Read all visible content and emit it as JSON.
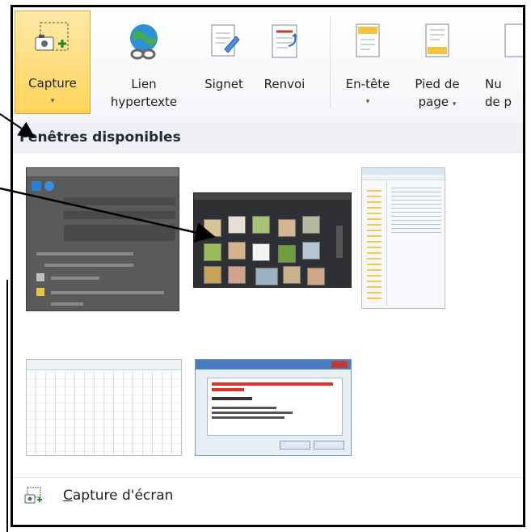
{
  "ribbon": {
    "buttons": [
      {
        "id": "capture",
        "label": "Capture",
        "has_arrow": true
      },
      {
        "id": "hyperlink",
        "label_line1": "Lien",
        "label_line2": "hypertexte"
      },
      {
        "id": "bookmark",
        "label": "Signet"
      },
      {
        "id": "cross_reference",
        "label": "Renvoi"
      },
      {
        "id": "header",
        "label": "En-tête",
        "has_arrow": true
      },
      {
        "id": "footer",
        "label_line1": "Pied de",
        "label_line2": "page"
      },
      {
        "id": "page_number",
        "label_line1": "Nu",
        "label_line2": "de p"
      }
    ],
    "dropdown_glyph": "▾"
  },
  "panel": {
    "title": "Fenêtres disponibles",
    "thumbnails": [
      {
        "id": "photoshop-like-panel"
      },
      {
        "id": "image-viewer"
      },
      {
        "id": "file-explorer"
      },
      {
        "id": "spreadsheet"
      },
      {
        "id": "update-dialog"
      }
    ]
  },
  "screen_capture": {
    "label_first": "C",
    "label_rest": "apture d'écran"
  },
  "colors": {
    "accent": "#ffd45a",
    "header_bg": "#eef0f3"
  }
}
